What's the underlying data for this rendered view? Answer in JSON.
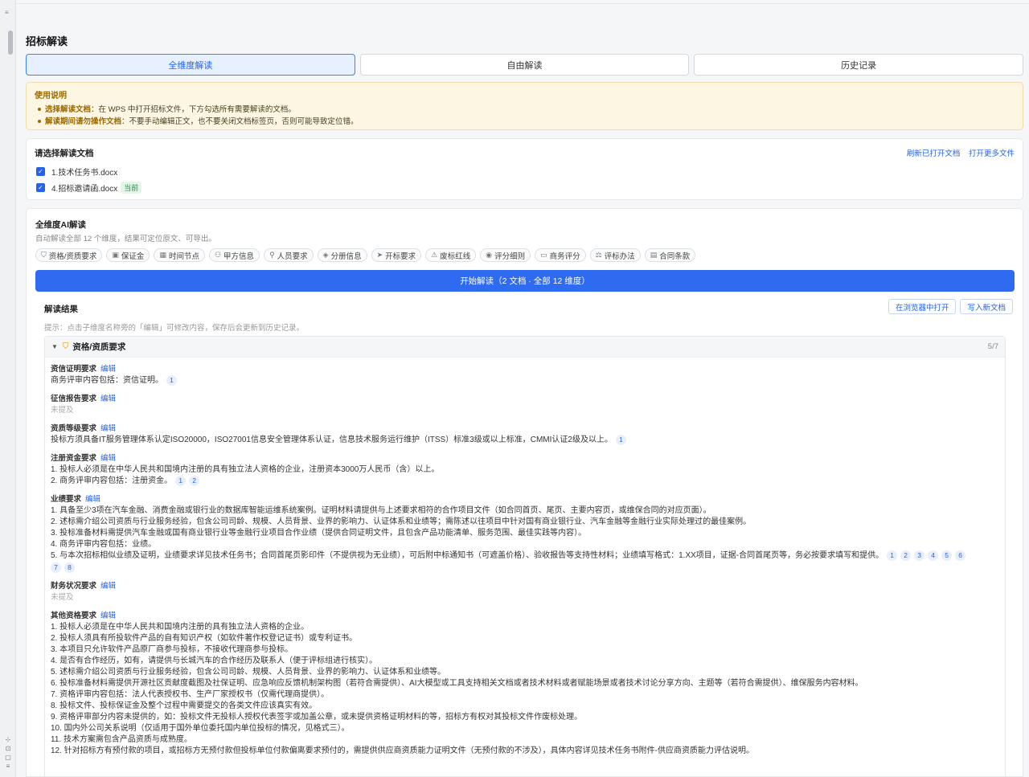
{
  "page_title": "招标解读",
  "tabs": [
    {
      "label": "全维度解读",
      "active": true
    },
    {
      "label": "自由解读",
      "active": false
    },
    {
      "label": "历史记录",
      "active": false
    }
  ],
  "notice": {
    "title": "使用说明",
    "items": [
      {
        "bold": "选择解读文档",
        "text": "：在 WPS 中打开招标文件，下方勾选所有需要解读的文档。"
      },
      {
        "bold": "解读期间请勿操作文档",
        "text": "：不要手动编辑正文，也不要关闭文档标签页，否则可能导致定位错。"
      }
    ]
  },
  "docs": {
    "title": "请选择解读文档",
    "refresh_link": "刷新已打开文档",
    "open_more_link": "打开更多文件",
    "files": [
      {
        "name": "1.技术任务书.docx",
        "checked": true,
        "badge": ""
      },
      {
        "name": "4.招标邀请函.docx",
        "checked": true,
        "badge": "当前"
      }
    ]
  },
  "ai": {
    "title": "全维度AI解读",
    "subtitle": "自动解读全部 12 个维度，结果可定位原文、可导出。",
    "chips": [
      {
        "label": "资格/资质要求",
        "icon": "shield-icon"
      },
      {
        "label": "保证金",
        "icon": "wallet-icon"
      },
      {
        "label": "时间节点",
        "icon": "calendar-icon"
      },
      {
        "label": "甲方信息",
        "icon": "people-icon"
      },
      {
        "label": "人员要求",
        "icon": "user-icon"
      },
      {
        "label": "分册信息",
        "icon": "layers-icon"
      },
      {
        "label": "开标要求",
        "icon": "send-icon"
      },
      {
        "label": "废标红线",
        "icon": "warning-icon"
      },
      {
        "label": "评分细则",
        "icon": "target-icon"
      },
      {
        "label": "商务评分",
        "icon": "briefcase-icon"
      },
      {
        "label": "评标办法",
        "icon": "scale-icon"
      },
      {
        "label": "合同条款",
        "icon": "file-icon"
      }
    ],
    "start_button": "开始解读（2 文档 · 全部 12 维度）"
  },
  "results": {
    "title": "解读结果",
    "open_browser_button": "在浏览器中打开",
    "write_doc_button": "写入新文档",
    "hint": "提示：点击子维度名称旁的「编辑」可修改内容，保存后会更新到历史记录。",
    "edit_label": "编辑",
    "section": {
      "title": "资格/资质要求",
      "count": "5/7",
      "subs": [
        {
          "label": "资信证明要求",
          "lines": [
            {
              "text": "商务评审内容包括：资信证明。",
              "refs": [
                "1"
              ]
            }
          ]
        },
        {
          "label": "征信报告要求",
          "empty": "未提及"
        },
        {
          "label": "资质等级要求",
          "lines": [
            {
              "text": "投标方须具备IT服务管理体系认定ISO20000，ISO27001信息安全管理体系认证，信息技术服务运行维护（ITSS）标准3级或以上标准，CMMI认证2级及以上。",
              "refs": [
                "1"
              ]
            }
          ]
        },
        {
          "label": "注册资金要求",
          "lines": [
            {
              "text": "1. 投标人必须是在中华人民共和国境内注册的具有独立法人资格的企业，注册资本3000万人民币（含）以上。",
              "refs": []
            },
            {
              "text": "2. 商务评审内容包括：注册资金。",
              "refs": [
                "1",
                "2"
              ]
            }
          ]
        },
        {
          "label": "业绩要求",
          "lines": [
            {
              "text": "1. 具备至少3项在汽车金融、消费金融或银行业的数据库智能运维系统案例。证明材料请提供与上述要求相符的合作项目文件（如合同首页、尾页、主要内容页，或维保合同的对应页面）。",
              "refs": []
            },
            {
              "text": "2. 述标需介绍公司资质与行业服务经验，包含公司司龄、规模、人员背景、业界的影响力、认证体系和业绩等；需陈述以往项目中针对国有商业银行业、汽车金融等金融行业实际处理过的最佳案例。",
              "refs": []
            },
            {
              "text": "3. 投标准备材料需提供汽车金融或国有商业银行业等金融行业项目合作业绩（提供合同证明文件，且包含产品功能清单、服务范围、最佳实践等内容）。",
              "refs": []
            },
            {
              "text": "4. 商务评审内容包括：业绩。",
              "refs": []
            },
            {
              "text": "5. 与本次招标相似业绩及证明，业绩要求详见技术任务书；合同首尾页影印件（不提供视为无业绩），可后附中标通知书（可遮盖价格）、验收报告等支持性材料；业绩填写格式：1.XX项目，证据-合同首尾页等，务必按要求填写和提供。",
              "refs": [
                "1",
                "2",
                "3",
                "4",
                "5",
                "6"
              ]
            },
            {
              "text": "",
              "refs": [
                "7",
                "8"
              ]
            }
          ]
        },
        {
          "label": "财务状况要求",
          "empty": "未提及"
        },
        {
          "label": "其他资格要求",
          "lines": [
            {
              "text": "1. 投标人必须是在中华人民共和国境内注册的具有独立法人资格的企业。",
              "refs": []
            },
            {
              "text": "2. 投标人须具有所投软件产品的自有知识产权（如软件著作权登记证书）或专利证书。",
              "refs": []
            },
            {
              "text": "3. 本项目只允许软件产品原厂商参与投标，不接收代理商参与投标。",
              "refs": []
            },
            {
              "text": "4. 是否有合作经历，如有，请提供与长城汽车的合作经历及联系人（便于评标组进行核实）。",
              "refs": []
            },
            {
              "text": "5. 述标需介绍公司资质与行业服务经验，包含公司司龄、规模、人员背景、业界的影响力、认证体系和业绩等。",
              "refs": []
            },
            {
              "text": "6. 投标准备材料需提供开源社区贡献度截图及社保证明、应急响应反馈机制架构图（若符合需提供）、AI大模型或工具支持相关文档或者技术材料或者赋能场景或者技术讨论分享方向、主题等（若符合需提供）、维保服务内容材料。",
              "refs": []
            },
            {
              "text": "7. 资格评审内容包括：法人代表授权书、生产厂家授权书（仅需代理商提供）。",
              "refs": []
            },
            {
              "text": "8. 投标文件、投标保证金及整个过程中需要提交的各类文件应该真实有效。",
              "refs": []
            },
            {
              "text": "9. 资格评审部分内容未提供的，如：投标文件无投标人授权代表签字或加盖公章，或未提供资格证明材料的等，招标方有权对其投标文件作废标处理。",
              "refs": []
            },
            {
              "text": "10. 国内外公司关系说明（仅适用于国外单位委托国内单位投标的情况，见格式三）。",
              "refs": []
            },
            {
              "text": "11. 技术方案需包含产品资质与成熟度。",
              "refs": []
            },
            {
              "text": "12. 针对招标方有预付款的项目，或招标方无预付款但投标单位付款偏离要求预付的，需提供供应商资质能力证明文件（无预付款的不涉及），具体内容详见技术任务书附件-供应商资质能力评估说明。",
              "refs": []
            }
          ]
        }
      ]
    }
  }
}
